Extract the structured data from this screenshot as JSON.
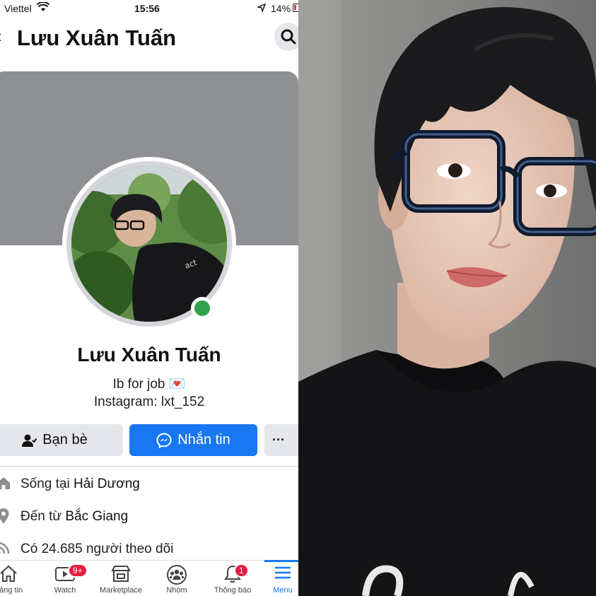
{
  "status_bar": {
    "carrier": "Viettel",
    "time": "15:56",
    "battery": "14%"
  },
  "header": {
    "title": "Lưu Xuân Tuấn"
  },
  "profile": {
    "name": "Lưu Xuân Tuấn",
    "bio": "Ib for job 💌",
    "instagram": "Instagram: lxt_152"
  },
  "actions": {
    "friends": "Bạn bè",
    "message": "Nhắn tin",
    "more": "···"
  },
  "info": {
    "lives_prefix": "Sống tại ",
    "lives_place": "Hải Dương",
    "from_prefix": "Đến từ ",
    "from_place": "Bắc Giang",
    "followers": "Có 24.685 người theo dõi"
  },
  "tabbar": {
    "home": "Bảng tin",
    "watch": "Watch",
    "watch_badge": "9+",
    "marketplace": "Marketplace",
    "groups": "Nhóm",
    "notifications": "Thông báo",
    "notifications_badge": "1",
    "menu": "Menu"
  },
  "colors": {
    "accent": "#1877f2",
    "online": "#31a24c",
    "badge": "#e41e3f"
  }
}
